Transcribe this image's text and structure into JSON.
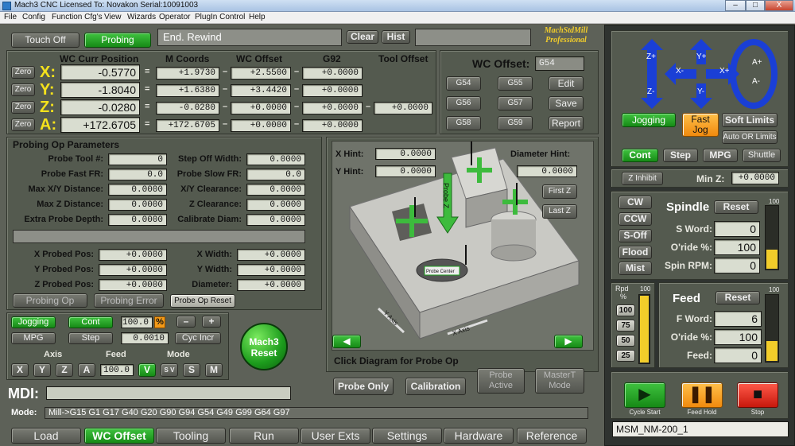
{
  "window": {
    "title": "Mach3 CNC  Licensed To: Novakon Serial:10091003",
    "btn_min": "–",
    "btn_max": "□",
    "btn_close": "X"
  },
  "menu": [
    "File",
    "Config",
    "Function Cfg's",
    "View",
    "Wizards",
    "Operator",
    "PlugIn Control",
    "Help"
  ],
  "top": {
    "touch_off": "Touch Off",
    "probing": "Probing",
    "status": "End. Rewind",
    "clear": "Clear",
    "hist": "Hist",
    "brand1": "MachStdMill",
    "brand2": "Professional"
  },
  "dro": {
    "headers": {
      "wc": "WC Curr Position",
      "m": "M Coords",
      "off": "WC Offset",
      "g92": "G92",
      "tool": "Tool Offset"
    },
    "zero": "Zero",
    "rows": [
      {
        "axis": "X:",
        "wc": "-0.5770",
        "m": "+1.9730",
        "off": "+2.5500",
        "g92": "+0.0000"
      },
      {
        "axis": "Y:",
        "wc": "-1.8040",
        "m": "+1.6380",
        "off": "+3.4420",
        "g92": "+0.0000"
      },
      {
        "axis": "Z:",
        "wc": "-0.0280",
        "m": "-0.0280",
        "off": "+0.0000",
        "g92": "+0.0000",
        "tool": "+0.0000"
      },
      {
        "axis": "A:",
        "wc": "+172.6705",
        "m": "+172.6705",
        "off": "+0.0000",
        "g92": "+0.0000"
      }
    ],
    "eq": "=",
    "dash": "–"
  },
  "wcoffset": {
    "label": "WC Offset:",
    "value": "G54",
    "g54": "G54",
    "g55": "G55",
    "g56": "G56",
    "g57": "G57",
    "g58": "G58",
    "g59": "G59",
    "edit": "Edit",
    "save": "Save",
    "report": "Report"
  },
  "probe": {
    "title": "Probing Op Parameters",
    "left": [
      {
        "label": "Probe Tool #:",
        "value": "0"
      },
      {
        "label": "Probe Fast FR:",
        "value": "0.0"
      },
      {
        "label": "Max X/Y Distance:",
        "value": "0.0000"
      },
      {
        "label": "Max Z Distance:",
        "value": "0.0000"
      },
      {
        "label": "Extra Probe Depth:",
        "value": "0.0000"
      }
    ],
    "right": [
      {
        "label": "Step Off Width:",
        "value": "0.0000"
      },
      {
        "label": "Probe Slow FR:",
        "value": "0.0"
      },
      {
        "label": "X/Y Clearance:",
        "value": "0.0000"
      },
      {
        "label": "Z Clearance:",
        "value": "0.0000"
      },
      {
        "label": "Calibrate Diam:",
        "value": "0.0000"
      }
    ],
    "pos": [
      {
        "label": "X Probed Pos:",
        "value": "+0.0000"
      },
      {
        "label": "Y Probed Pos:",
        "value": "+0.0000"
      },
      {
        "label": "Z Probed Pos:",
        "value": "+0.0000"
      }
    ],
    "size": [
      {
        "label": "X Width:",
        "value": "+0.0000"
      },
      {
        "label": "Y Width:",
        "value": "+0.0000"
      },
      {
        "label": "Diameter:",
        "value": "+0.0000"
      }
    ],
    "probing_op": "Probing Op",
    "probing_error": "Probing Error",
    "probe_op_reset": "Probe Op Reset"
  },
  "diagram": {
    "x_hint": "X Hint:",
    "x_hint_val": "0.0000",
    "y_hint": "Y Hint:",
    "y_hint_val": "0.0000",
    "diam_hint": "Diameter Hint:",
    "diam_hint_val": "0.0000",
    "first_z": "First Z",
    "last_z": "Last Z",
    "probe_z": "Probe Z",
    "probe_center": "Probe Center",
    "y_axis": "Y Axis",
    "x_axis": "X Axis",
    "click": "Click Diagram for Probe Op",
    "probe_only": "Probe Only",
    "calibration": "Calibration",
    "probe_active1": "Probe",
    "probe_active2": "Active",
    "master1": "MasterT",
    "master2": "Mode"
  },
  "jog": {
    "jogging": "Jogging",
    "cont": "Cont",
    "pct": "100.0",
    "pct_sign": "%",
    "minus": "–",
    "plus": "+",
    "mpg": "MPG",
    "step": "Step",
    "step_val": "0.0010",
    "cyc": "Cyc Incr",
    "axis": "Axis",
    "feed": "Feed",
    "mode": "Mode",
    "x": "X",
    "y": "Y",
    "z": "Z",
    "a": "A",
    "feed_val": "100.0",
    "v": "V",
    "sv": "S V",
    "s": "S",
    "m": "M",
    "reset1": "Mach3",
    "reset2": "Reset"
  },
  "mdi": {
    "label": "MDI:"
  },
  "mode": {
    "label": "Mode:",
    "value": "Mill->G15  G1 G17 G40 G20 G90 G94 G54 G49 G99 G64 G97"
  },
  "tabs": [
    "Load",
    "WC Offset",
    "Tooling",
    "Run",
    "User Exts",
    "Settings",
    "Hardware",
    "Reference"
  ],
  "right": {
    "z_plus": "Z+",
    "z_minus": "Z-",
    "y_plus": "Y+",
    "y_minus": "Y-",
    "x_minus": "X-",
    "x_plus": "X+",
    "a_plus": "A+",
    "a_minus": "A-",
    "jogging": "Jogging",
    "fast1": "Fast",
    "fast2": "Jog",
    "soft": "Soft Limits",
    "auto_or": "Auto OR Limits",
    "cont": "Cont",
    "step": "Step",
    "mpg": "MPG",
    "shuttle": "Shuttle",
    "z_inhibit": "Z Inhibit",
    "min_z": "Min Z:",
    "min_z_val": "+0.0000",
    "cw": "CW",
    "ccw": "CCW",
    "s_off": "S-Off",
    "flood": "Flood",
    "mist": "Mist",
    "spindle": "Spindle",
    "reset": "Reset",
    "s_word": "S Word:",
    "s_word_val": "0",
    "oride": "O'ride %:",
    "oride_val": "100",
    "spin_rpm": "Spin RPM:",
    "spin_rpm_val": "0",
    "bar_max": "100",
    "rpd": "Rpd",
    "rpd_pct": "%",
    "rpd_vals": [
      "100",
      "75",
      "50",
      "25"
    ],
    "feed": "Feed",
    "f_word": "F Word:",
    "f_word_val": "6",
    "f_oride_val": "100",
    "feed_lbl": "Feed:",
    "feed_val": "0",
    "cycle_start": "Cycle Start",
    "feed_hold": "Feed Hold",
    "stop": "Stop",
    "profile": "MSM_NM-200_1",
    "spindle_level": 0.3,
    "rapid_level": 1.0,
    "feed_level": 0.3
  },
  "colors": {
    "accent_green": "#1e9e1e",
    "accent_orange": "#f39a18",
    "lcd": "#d9ddd0",
    "axis_yellow": "#f5e21c",
    "jog_blue": "#1a3fd6"
  }
}
